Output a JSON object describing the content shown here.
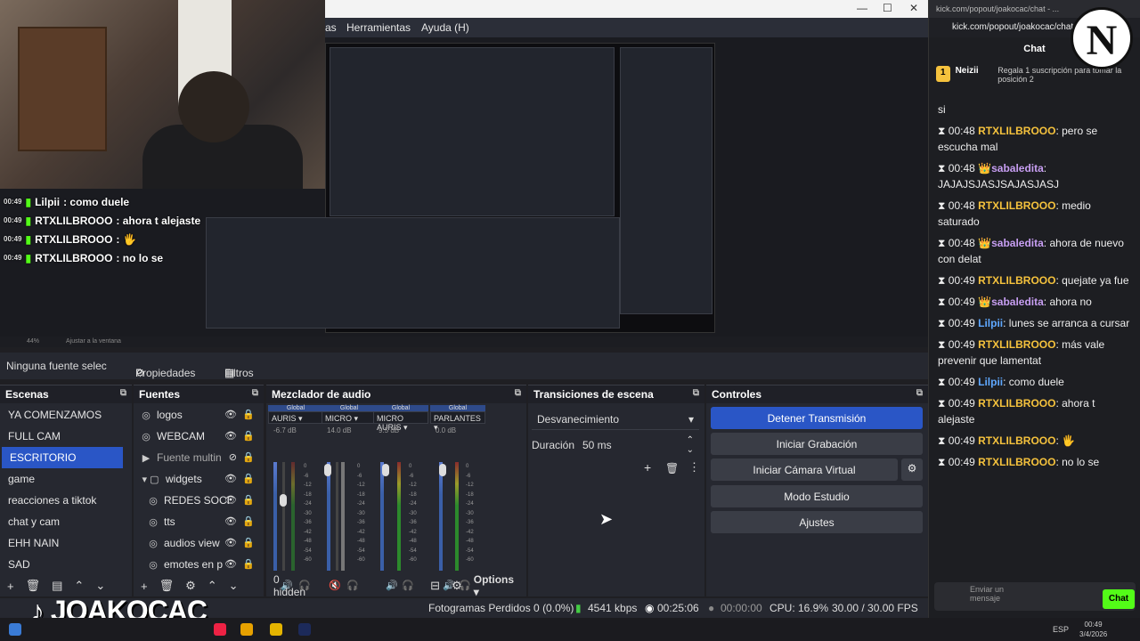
{
  "window": {
    "controls": [
      "—",
      "☐",
      "✕"
    ]
  },
  "menu": {
    "items": [
      "as",
      "Herramientas",
      "Ayuda (H)"
    ]
  },
  "preview": {
    "zoom": "44%",
    "fit": "Ajustar a la ventana"
  },
  "overlay_chat": [
    {
      "time": "00:49",
      "user": "Lilpii",
      "text": ": como duele"
    },
    {
      "time": "00:49",
      "user": "RTXLILBROOO",
      "text": ": ahora t alejaste"
    },
    {
      "time": "00:49",
      "user": "RTXLILBROOO",
      "text": ":"
    },
    {
      "time": "00:49",
      "user": "RTXLILBROOO",
      "text": ": no lo se"
    }
  ],
  "source_toolbar": {
    "no_source": "Ninguna fuente selec",
    "properties": "Propiedades",
    "filters": "Filtros"
  },
  "scenes": {
    "title": "Escenas",
    "items": [
      "YA COMENZAMOS",
      "FULL CAM",
      "ESCRITORIO",
      "game",
      "reacciones a tiktok",
      "chat y cam",
      "EHH NAIN",
      "SAD"
    ],
    "selected": 2
  },
  "sources": {
    "title": "Fuentes",
    "items": [
      {
        "icon": "◎",
        "label": "logos"
      },
      {
        "icon": "◎",
        "label": "WEBCAM"
      },
      {
        "icon": "▶",
        "label": "Fuente multin"
      },
      {
        "icon": "▾ ▢",
        "label": "widgets"
      },
      {
        "icon": "◎",
        "label": "REDES SOCI"
      },
      {
        "icon": "◎",
        "label": "tts"
      },
      {
        "icon": "◎",
        "label": "audios view"
      },
      {
        "icon": "◎",
        "label": "emotes en p"
      }
    ]
  },
  "mixer": {
    "title": "Mezclador de audio",
    "global_label": "Global",
    "channels": [
      {
        "name": "AURIS",
        "db": "-6.7 dB"
      },
      {
        "name": "MICRO",
        "db": "14.0 dB"
      },
      {
        "name": "MICRO AURIS",
        "db": "9.5 dB"
      },
      {
        "name": "PARLANTES",
        "db": "0.0 dB"
      }
    ],
    "scale": [
      "0",
      "-6",
      "-12",
      "-18",
      "-24",
      "-30",
      "-36",
      "-42",
      "-48",
      "-54",
      "-60"
    ],
    "hidden": "0 hidden",
    "options": "Options"
  },
  "transitions": {
    "title": "Transiciones de escena",
    "selected": "Desvanecimiento",
    "duration_label": "Duración",
    "duration_value": "50 ms"
  },
  "controls": {
    "title": "Controles",
    "buttons": [
      "Detener Transmisión",
      "Iniciar Grabación",
      "Iniciar Cámara Virtual",
      "Modo Estudio",
      "Ajustes"
    ]
  },
  "status": {
    "frames": "Fotogramas Perdidos 0 (0.0%)",
    "kbps": "4541 kbps",
    "live_time": "00:25:06",
    "rec_time": "00:00:00",
    "cpu": "CPU: 16.9%",
    "fps": "30.00 / 30.00 FPS"
  },
  "branding": {
    "logo": "JOAKOCAC",
    "channel_logo": "N"
  },
  "chat": {
    "url": "kick.com/popout/joakocac/chat - ...",
    "url2": "kick.com/popout/joakocac/chat",
    "title": "Chat",
    "pinned_user": "Neizii",
    "pinned_rank": "1",
    "pinned_text": "Regala 1 suscripción para tomar la posición 2",
    "messages": [
      {
        "time": "",
        "user": "",
        "text": "si",
        "color": "u1"
      },
      {
        "time": "00:48",
        "user": "RTXLILBROOO",
        "text": ": pero se escucha mal",
        "color": "u1"
      },
      {
        "time": "00:48",
        "user": "sabaledita",
        "text": ": JAJAJSJASJSAJASJASJ",
        "color": "u2"
      },
      {
        "time": "00:48",
        "user": "RTXLILBROOO",
        "text": ": medio saturado",
        "color": "u1"
      },
      {
        "time": "00:48",
        "user": "sabaledita",
        "text": ": ahora de nuevo con delat",
        "color": "u2"
      },
      {
        "time": "00:49",
        "user": "RTXLILBROOO",
        "text": ": quejate ya fue",
        "color": "u1"
      },
      {
        "time": "00:49",
        "user": "sabaledita",
        "text": ": ahora no",
        "color": "u2"
      },
      {
        "time": "00:49",
        "user": "Lilpii",
        "text": ": lunes se arranca a cursar",
        "color": "u3"
      },
      {
        "time": "00:49",
        "user": "RTXLILBROOO",
        "text": ": más vale prevenir que lamentat",
        "color": "u1"
      },
      {
        "time": "00:49",
        "user": "Lilpii",
        "text": ": como duele",
        "color": "u3"
      },
      {
        "time": "00:49",
        "user": "RTXLILBROOO",
        "text": ": ahora t alejaste",
        "color": "u1"
      },
      {
        "time": "00:49",
        "user": "RTXLILBROOO",
        "text": ":",
        "color": "u1"
      },
      {
        "time": "00:49",
        "user": "RTXLILBROOO",
        "text": ": no lo se",
        "color": "u1"
      }
    ],
    "input_placeholder": "Enviar un mensaje",
    "send_label": "Chat"
  },
  "taskbar": {
    "lang": "ESP",
    "time": "00:49",
    "date": "3/4/2026"
  },
  "colors": {
    "accent": "#2a56c6",
    "kick_green": "#53fc18"
  }
}
